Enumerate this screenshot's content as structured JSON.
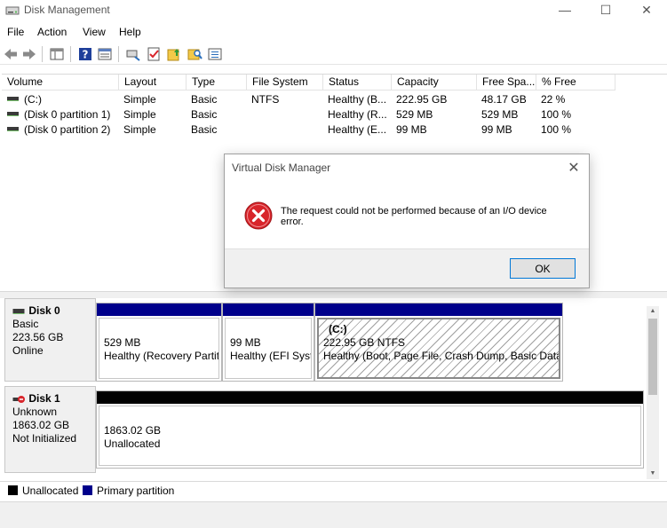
{
  "window": {
    "title": "Disk Management",
    "minimize_glyph": "—",
    "maximize_glyph": "☐",
    "close_glyph": "✕"
  },
  "menu": [
    "File",
    "Action",
    "View",
    "Help"
  ],
  "toolbar": {
    "icons": [
      "back-arrow-icon",
      "forward-arrow-icon",
      "show-hide-console-tree-icon",
      "help-icon",
      "properties-icon",
      "connect-icon",
      "checklist-icon",
      "folder-up-icon",
      "search-folder-icon",
      "list-view-icon"
    ]
  },
  "volume_list": {
    "columns": [
      "Volume",
      "Layout",
      "Type",
      "File System",
      "Status",
      "Capacity",
      "Free Spa...",
      "% Free"
    ],
    "rows": [
      {
        "volume": "(C:)",
        "layout": "Simple",
        "type": "Basic",
        "file_system": "NTFS",
        "status": "Healthy (B...",
        "capacity": "222.95 GB",
        "free_space": "48.17 GB",
        "pct_free": "22 %"
      },
      {
        "volume": "(Disk 0 partition 1)",
        "layout": "Simple",
        "type": "Basic",
        "file_system": "",
        "status": "Healthy (R...",
        "capacity": "529 MB",
        "free_space": "529 MB",
        "pct_free": "100 %"
      },
      {
        "volume": "(Disk 0 partition 2)",
        "layout": "Simple",
        "type": "Basic",
        "file_system": "",
        "status": "Healthy (E...",
        "capacity": "99 MB",
        "free_space": "99 MB",
        "pct_free": "100 %"
      }
    ]
  },
  "disks": [
    {
      "name": "Disk 0",
      "type": "Basic",
      "size": "223.56 GB",
      "state": "Online",
      "partitions": [
        {
          "label": "",
          "size": "529 MB",
          "status": "Healthy (Recovery Partit"
        },
        {
          "label": "",
          "size": "99 MB",
          "status": "Healthy (EFI Syst"
        },
        {
          "label": "(C:)",
          "size": "222.95 GB NTFS",
          "status": "Healthy (Boot, Page File, Crash Dump, Basic Data P"
        }
      ]
    },
    {
      "name": "Disk 1",
      "type": "Unknown",
      "size": "1863.02 GB",
      "state": "Not Initialized",
      "partitions": [
        {
          "label": "",
          "size": "1863.02 GB",
          "status": "Unallocated"
        }
      ]
    }
  ],
  "legend": [
    {
      "label": "Unallocated",
      "color": "#000000"
    },
    {
      "label": "Primary partition",
      "color": "#00008b"
    }
  ],
  "colors": {
    "primary_partition": "#00008b",
    "unallocated": "#000000",
    "error_red": "#d8252b",
    "accent": "#0078d7"
  },
  "dialog": {
    "title": "Virtual Disk Manager",
    "message_line1": "The request could not be performed because of an I/O device",
    "message_line2": "error.",
    "ok_label": "OK",
    "close_glyph": "✕"
  }
}
